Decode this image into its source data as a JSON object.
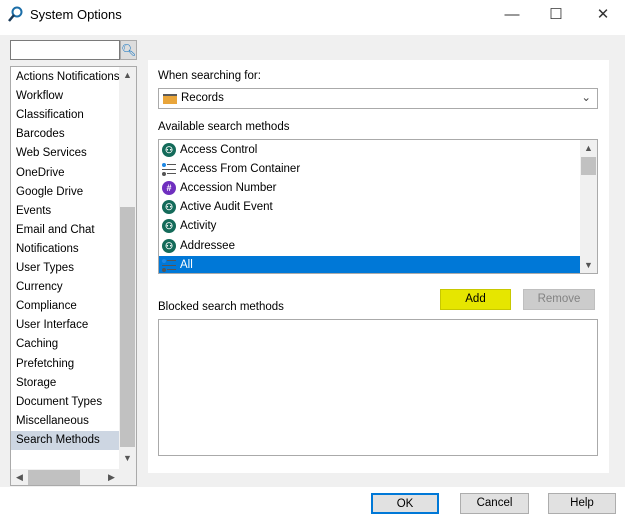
{
  "window": {
    "title": "System Options",
    "minimize": "—",
    "maximize": "☐",
    "close": "✕"
  },
  "sidebar": {
    "search_value": "",
    "items": [
      "Actions Notifications",
      "Workflow",
      "Classification",
      "Barcodes",
      "Web Services",
      "OneDrive",
      "Google Drive",
      "Events",
      "Email and Chat",
      "Notifications",
      "User Types",
      "Currency",
      "Compliance",
      "User Interface",
      "Caching",
      "Prefetching",
      "Storage",
      "Document Types",
      "Miscellaneous",
      "Search Methods"
    ],
    "selected": "Search Methods"
  },
  "main": {
    "searching_label": "When searching for:",
    "searching_value": "Records",
    "available_label": "Available search methods",
    "available": [
      {
        "label": "Access Control",
        "icon": "person"
      },
      {
        "label": "Access From Container",
        "icon": "list"
      },
      {
        "label": "Accession Number",
        "icon": "hash"
      },
      {
        "label": "Active Audit Event",
        "icon": "person"
      },
      {
        "label": "Activity",
        "icon": "person"
      },
      {
        "label": "Addressee",
        "icon": "person"
      },
      {
        "label": "All",
        "icon": "list"
      }
    ],
    "selected": "All",
    "add_label": "Add",
    "remove_label": "Remove",
    "blocked_label": "Blocked search methods",
    "blocked": []
  },
  "footer": {
    "ok": "OK",
    "cancel": "Cancel",
    "help": "Help"
  },
  "colors": {
    "selection": "#0078d7",
    "add_highlight": "#e6e600"
  }
}
